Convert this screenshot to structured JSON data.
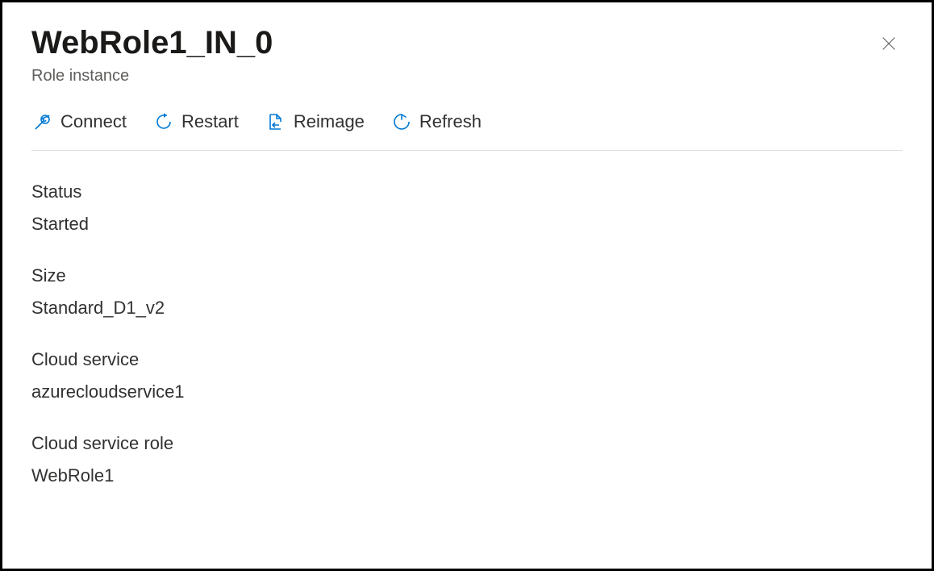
{
  "header": {
    "title": "WebRole1_IN_0",
    "subtitle": "Role instance"
  },
  "toolbar": {
    "connect": "Connect",
    "restart": "Restart",
    "reimage": "Reimage",
    "refresh": "Refresh"
  },
  "properties": {
    "status_label": "Status",
    "status_value": "Started",
    "size_label": "Size",
    "size_value": "Standard_D1_v2",
    "cloud_service_label": "Cloud service",
    "cloud_service_value": "azurecloudservice1",
    "cloud_service_role_label": "Cloud service role",
    "cloud_service_role_value": "WebRole1"
  }
}
